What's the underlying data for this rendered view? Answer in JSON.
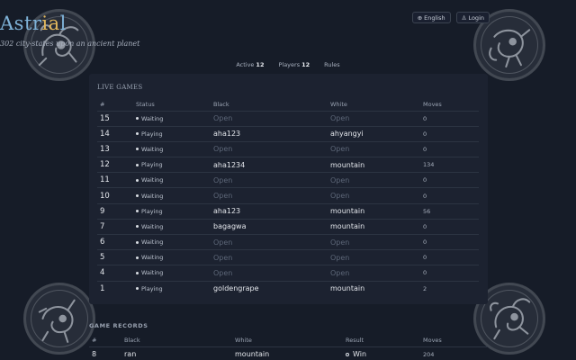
{
  "header": {
    "title_part1": "Astr",
    "title_part2": "ia",
    "title_part3": "l",
    "subtitle": "302 city-states upon an ancient planet",
    "language_button": "English",
    "login_button": "Login"
  },
  "nav": {
    "active_label": "Active",
    "active_count": "12",
    "players_label": "Players",
    "players_count": "12",
    "rules_label": "Rules"
  },
  "live_games": {
    "title": "LIVE GAMES",
    "columns": [
      "#",
      "Status",
      "Black",
      "White",
      "Moves"
    ],
    "rows": [
      {
        "id": "15",
        "status": "Waiting",
        "black": "Open",
        "white": "Open",
        "moves": "0",
        "open": true
      },
      {
        "id": "14",
        "status": "Playing",
        "black": "aha123",
        "white": "ahyangyi",
        "moves": "0",
        "open": false
      },
      {
        "id": "13",
        "status": "Waiting",
        "black": "Open",
        "white": "Open",
        "moves": "0",
        "open": true
      },
      {
        "id": "12",
        "status": "Playing",
        "black": "aha1234",
        "white": "mountain",
        "moves": "134",
        "open": false
      },
      {
        "id": "11",
        "status": "Waiting",
        "black": "Open",
        "white": "Open",
        "moves": "0",
        "open": true
      },
      {
        "id": "10",
        "status": "Waiting",
        "black": "Open",
        "white": "Open",
        "moves": "0",
        "open": true
      },
      {
        "id": "9",
        "status": "Playing",
        "black": "aha123",
        "white": "mountain",
        "moves": "56",
        "open": false
      },
      {
        "id": "7",
        "status": "Waiting",
        "black": "bagagwa",
        "white": "mountain",
        "moves": "0",
        "open": false
      },
      {
        "id": "6",
        "status": "Waiting",
        "black": "Open",
        "white": "Open",
        "moves": "0",
        "open": true
      },
      {
        "id": "5",
        "status": "Waiting",
        "black": "Open",
        "white": "Open",
        "moves": "0",
        "open": true
      },
      {
        "id": "4",
        "status": "Waiting",
        "black": "Open",
        "white": "Open",
        "moves": "0",
        "open": true
      },
      {
        "id": "1",
        "status": "Playing",
        "black": "goldengrape",
        "white": "mountain",
        "moves": "2",
        "open": false
      }
    ]
  },
  "game_records": {
    "title": "GAME RECORDS",
    "columns": [
      "#",
      "Black",
      "White",
      "Result",
      "Moves"
    ],
    "rows": [
      {
        "id": "8",
        "black": "ran",
        "white": "mountain",
        "result": "Win",
        "moves": "204"
      }
    ]
  }
}
